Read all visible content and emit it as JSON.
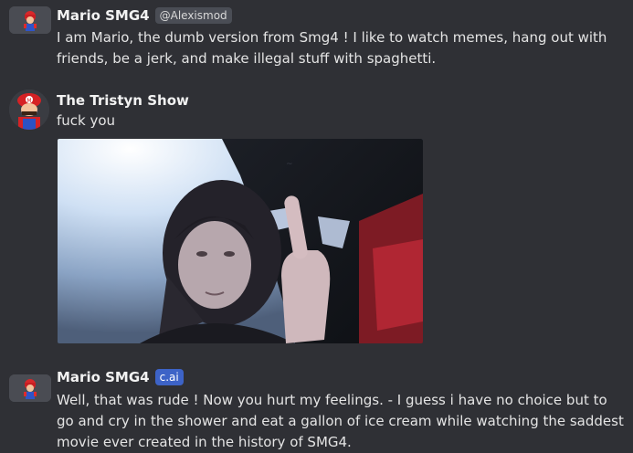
{
  "messages": [
    {
      "author": "Mario SMG4",
      "handle": "@Alexismod",
      "text": "I am Mario, the dumb version from Smg4 ! I like to watch memes, hang out with friends, be a jerk, and make illegal stuff with spaghetti."
    },
    {
      "author": "The Tristyn Show",
      "text": "fuck you",
      "attachment": "photo-attachment"
    },
    {
      "author": "Mario SMG4",
      "badge": "c.ai",
      "text": "Well, that was rude ! Now you hurt my feelings. - I guess i have no choice but to go and cry in the shower and eat a gallon of ice cream while watching the saddest movie ever created in the history of SMG4."
    }
  ],
  "colors": {
    "background": "#2f3035",
    "badge_cai": "#3d63c7",
    "badge_handle": "#4a4d55"
  }
}
